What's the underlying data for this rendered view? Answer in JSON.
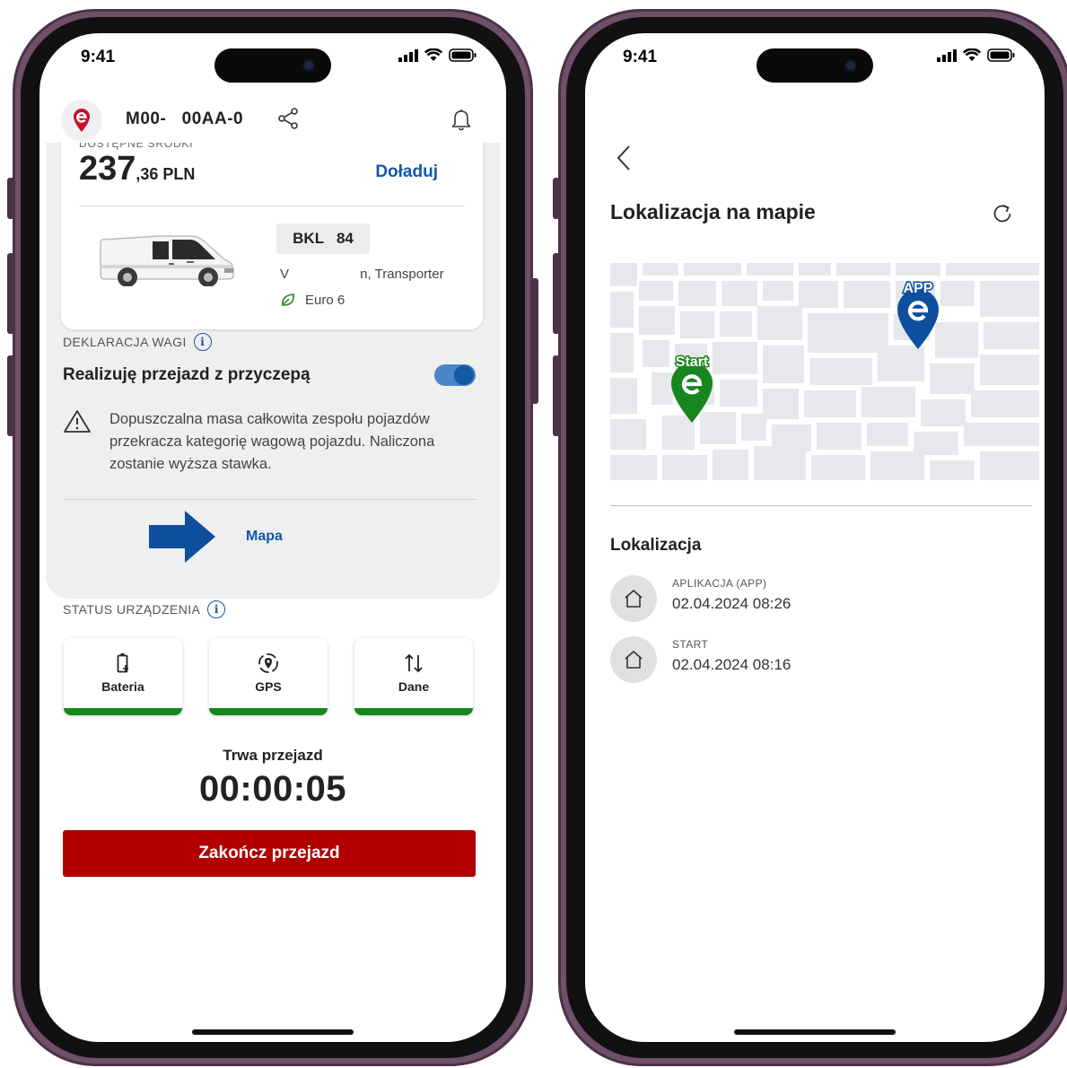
{
  "status_bar": {
    "time": "9:41"
  },
  "left_screen": {
    "header": {
      "plate": "M00-   00AA-0"
    },
    "funds": {
      "label": "DOSTĘPNE ŚRODKI",
      "amount_whole": "237",
      "amount_fraction": ",36 PLN",
      "topup_label": "Doładuj"
    },
    "vehicle": {
      "registration": "BKL   84",
      "model": "V                   n, Transporter",
      "emission": "Euro 6"
    },
    "weight_declaration": {
      "label": "DEKLARACJA WAGI",
      "trailer_label": "Realizuję przejazd z przyczepą",
      "trailer_on": true,
      "warning": "Dopuszczalna masa całkowita zespołu pojazdów przekracza kategorię wagową pojazdu. Naliczona zostanie wyższa stawka."
    },
    "map_link": "Mapa",
    "device_status": {
      "label": "STATUS URZĄDZENIA",
      "tiles": [
        {
          "label": "Bateria",
          "icon": "battery-charging-icon",
          "status_color": "#17861e"
        },
        {
          "label": "GPS",
          "icon": "gps-location-icon",
          "status_color": "#17861e"
        },
        {
          "label": "Dane",
          "icon": "data-transfer-icon",
          "status_color": "#17861e"
        }
      ]
    },
    "trip": {
      "label": "Trwa przejazd",
      "timer": "00:00:05",
      "end_button": "Zakończ przejazd"
    }
  },
  "right_screen": {
    "title": "Lokalizacja na mapie",
    "map": {
      "markers": [
        {
          "label": "Start",
          "color": "#17861e"
        },
        {
          "label": "APP",
          "color": "#0d4f9e"
        }
      ]
    },
    "location_section": {
      "title": "Lokalizacja",
      "items": [
        {
          "caption": "APLIKACJA (APP)",
          "datetime": "02.04.2024 08:26"
        },
        {
          "caption": "START",
          "datetime": "02.04.2024 08:16"
        }
      ]
    }
  },
  "colors": {
    "brand_blue": "#1458a6",
    "brand_red": "#c8102e",
    "end_button": "#b20000",
    "ok_green": "#17861e"
  }
}
